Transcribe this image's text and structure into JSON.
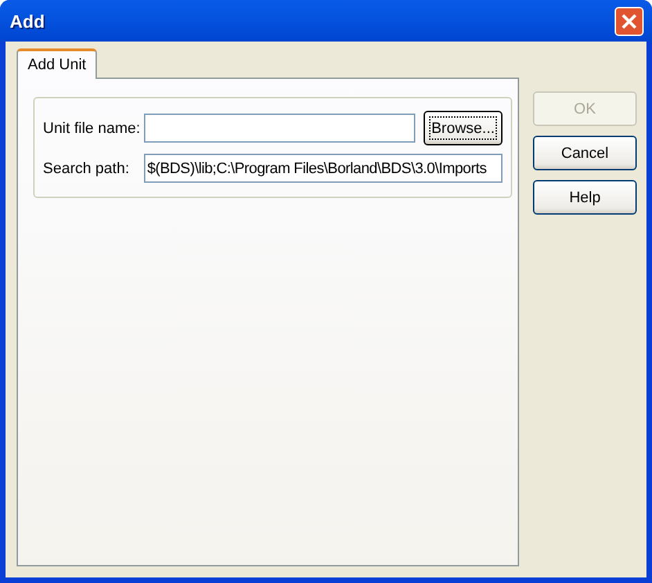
{
  "window": {
    "title": "Add"
  },
  "tabs": [
    {
      "label": "Add Unit",
      "selected": true
    }
  ],
  "fields": [
    {
      "label": "Unit file name:"
    },
    {
      "label": "Search path:",
      "value": "$(BDS)\\lib;C:\\Program Files\\Borland\\BDS\\3.0\\Imports"
    }
  ],
  "browse_button": {
    "label": "Browse...",
    "focused": true
  },
  "buttons": [
    {
      "label": "OK",
      "disabled": true
    },
    {
      "label": "Cancel",
      "disabled": false
    },
    {
      "label": "Help",
      "disabled": false
    }
  ]
}
